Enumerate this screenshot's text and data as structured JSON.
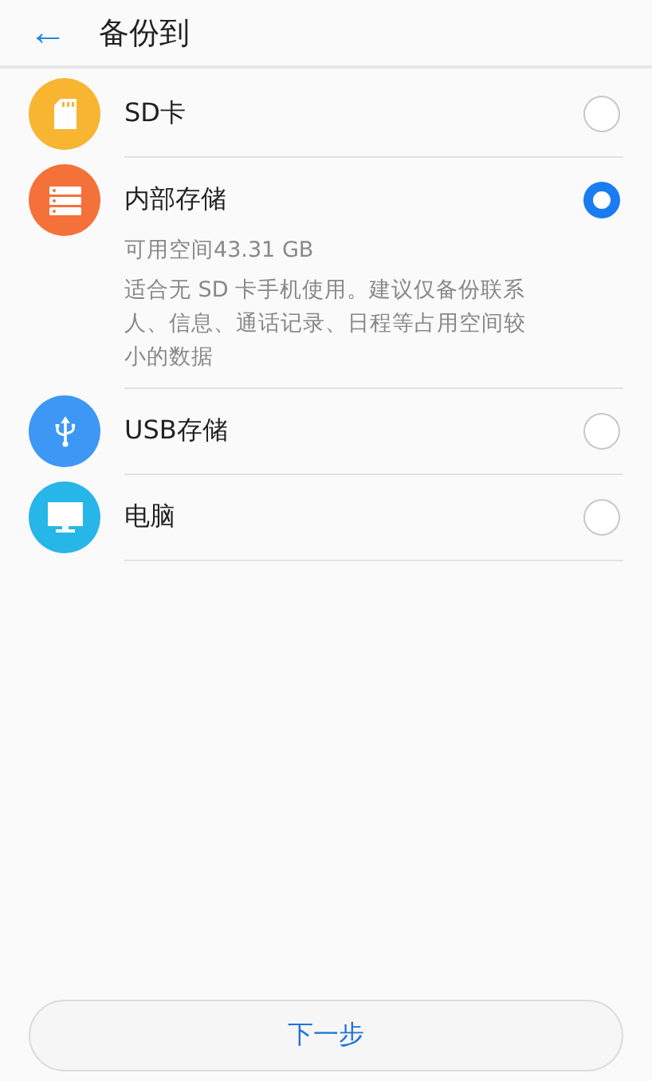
{
  "header": {
    "back": "←",
    "title": "备份到"
  },
  "options": [
    {
      "kind": "sd",
      "name": "SD卡",
      "selected": false
    },
    {
      "kind": "storage",
      "name": "内部存储",
      "selected": true,
      "free_space": "可用空间43.31 GB",
      "description": "适合无 SD 卡手机使用。建议仅备份联系人、信息、通话记录、日程等占用空间较小的数据"
    },
    {
      "kind": "usb",
      "name": "USB存储",
      "selected": false
    },
    {
      "kind": "pc",
      "name": "电脑",
      "selected": false
    }
  ],
  "next_button": "下一步"
}
